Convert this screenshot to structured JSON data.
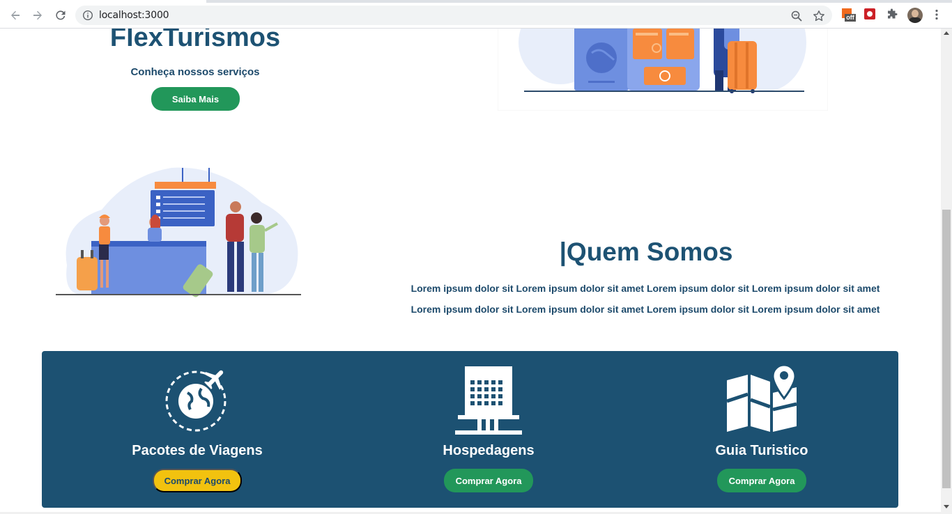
{
  "browser": {
    "url": "localhost:3000",
    "extension_badge": "off"
  },
  "hero": {
    "title": "FlexTurismos",
    "subtitle": "Conheça nossos serviços",
    "cta_label": "Saiba Mais"
  },
  "about": {
    "title": "|Quem Somos",
    "line1": "Lorem ipsum dolor sit Lorem ipsum dolor sit amet Lorem ipsum dolor sit Lorem ipsum dolor sit amet",
    "line2": "Lorem ipsum dolor sit Lorem ipsum dolor sit amet Lorem ipsum dolor sit Lorem ipsum dolor sit amet"
  },
  "services": [
    {
      "title": "Pacotes de Viagens",
      "button": "Comprar Agora",
      "icon": "globe-plane-icon",
      "button_color": "#f2c20f"
    },
    {
      "title": "Hospedagens",
      "button": "Comprar Agora",
      "icon": "hotel-building-icon",
      "button_color": "#22975a"
    },
    {
      "title": "Guia Turistico",
      "button": "Comprar Agora",
      "icon": "map-pin-icon",
      "button_color": "#22975a"
    }
  ],
  "colors": {
    "primary": "#1d5273",
    "services_bg": "#1c5172",
    "green": "#22975a",
    "yellow": "#f2c20f"
  }
}
